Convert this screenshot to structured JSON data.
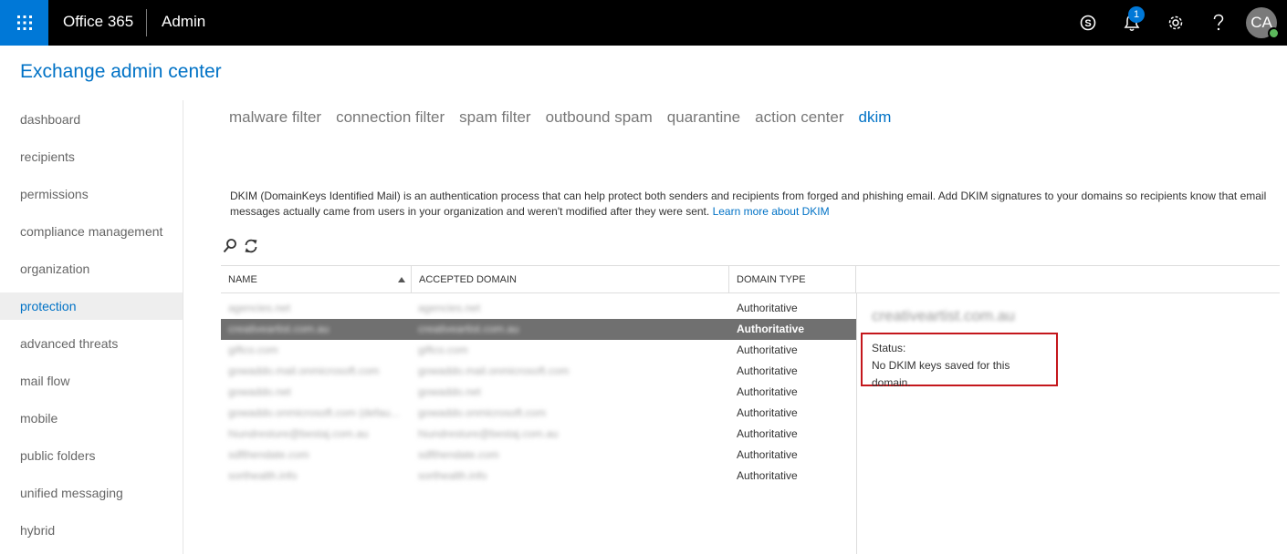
{
  "header": {
    "brand": "Office 365",
    "app_name": "Admin",
    "notification_count": "1",
    "avatar_initials": "CA"
  },
  "page_title": "Exchange admin center",
  "sidebar": {
    "items": [
      {
        "label": "dashboard",
        "active": false
      },
      {
        "label": "recipients",
        "active": false
      },
      {
        "label": "permissions",
        "active": false
      },
      {
        "label": "compliance management",
        "active": false
      },
      {
        "label": "organization",
        "active": false
      },
      {
        "label": "protection",
        "active": true
      },
      {
        "label": "advanced threats",
        "active": false
      },
      {
        "label": "mail flow",
        "active": false
      },
      {
        "label": "mobile",
        "active": false
      },
      {
        "label": "public folders",
        "active": false
      },
      {
        "label": "unified messaging",
        "active": false
      },
      {
        "label": "hybrid",
        "active": false
      }
    ]
  },
  "tabs": [
    {
      "label": "malware filter",
      "active": false
    },
    {
      "label": "connection filter",
      "active": false
    },
    {
      "label": "spam filter",
      "active": false
    },
    {
      "label": "outbound spam",
      "active": false
    },
    {
      "label": "quarantine",
      "active": false
    },
    {
      "label": "action center",
      "active": false
    },
    {
      "label": "dkim",
      "active": true
    }
  ],
  "description": {
    "text": "DKIM (DomainKeys Identified Mail) is an authentication process that can help protect both senders and recipients from forged and phishing email. Add DKIM signatures to your domains so recipients know that email messages actually came from users in your organization and weren't modified after they were sent.",
    "link": "Learn more about DKIM"
  },
  "grid": {
    "columns": [
      "NAME",
      "ACCEPTED DOMAIN",
      "DOMAIN TYPE"
    ],
    "rows": [
      {
        "name": "agencies.net",
        "domain": "agencies.net",
        "type": "Authoritative",
        "selected": false
      },
      {
        "name": "creativeartist.com.au",
        "domain": "creativeartist.com.au",
        "type": "Authoritative",
        "selected": true
      },
      {
        "name": "giftco.com",
        "domain": "giftco.com",
        "type": "Authoritative",
        "selected": false
      },
      {
        "name": "gowaddo.mail.onmicrosoft.com",
        "domain": "gowaddo.mail.onmicrosoft.com",
        "type": "Authoritative",
        "selected": false
      },
      {
        "name": "gowaddo.net",
        "domain": "gowaddo.net",
        "type": "Authoritative",
        "selected": false
      },
      {
        "name": "gowaddo.onmicrosoft.com (defau...",
        "domain": "gowaddo.onmicrosoft.com",
        "type": "Authoritative",
        "selected": false
      },
      {
        "name": "hiundresture@bestaj.com.au",
        "domain": "hiundresture@bestaj.com.au",
        "type": "Authoritative",
        "selected": false
      },
      {
        "name": "sdfthendate.com",
        "domain": "sdfthendate.com",
        "type": "Authoritative",
        "selected": false
      },
      {
        "name": "sorthealth.info",
        "domain": "sorthealth.info",
        "type": "Authoritative",
        "selected": false
      }
    ]
  },
  "detail": {
    "domain": "creativeartist.com.au",
    "status_label": "Status:",
    "status_value": "No DKIM keys saved for this domain."
  },
  "colors": {
    "accent": "#0072c6",
    "waffle": "#0078d7",
    "highlight_border": "#c4171c",
    "selected_row": "#707070"
  },
  "icons": [
    "app-launcher-icon",
    "skype-icon",
    "bell-icon",
    "gear-icon",
    "help-icon",
    "search-icon",
    "refresh-icon",
    "sort-ascending-icon"
  ]
}
